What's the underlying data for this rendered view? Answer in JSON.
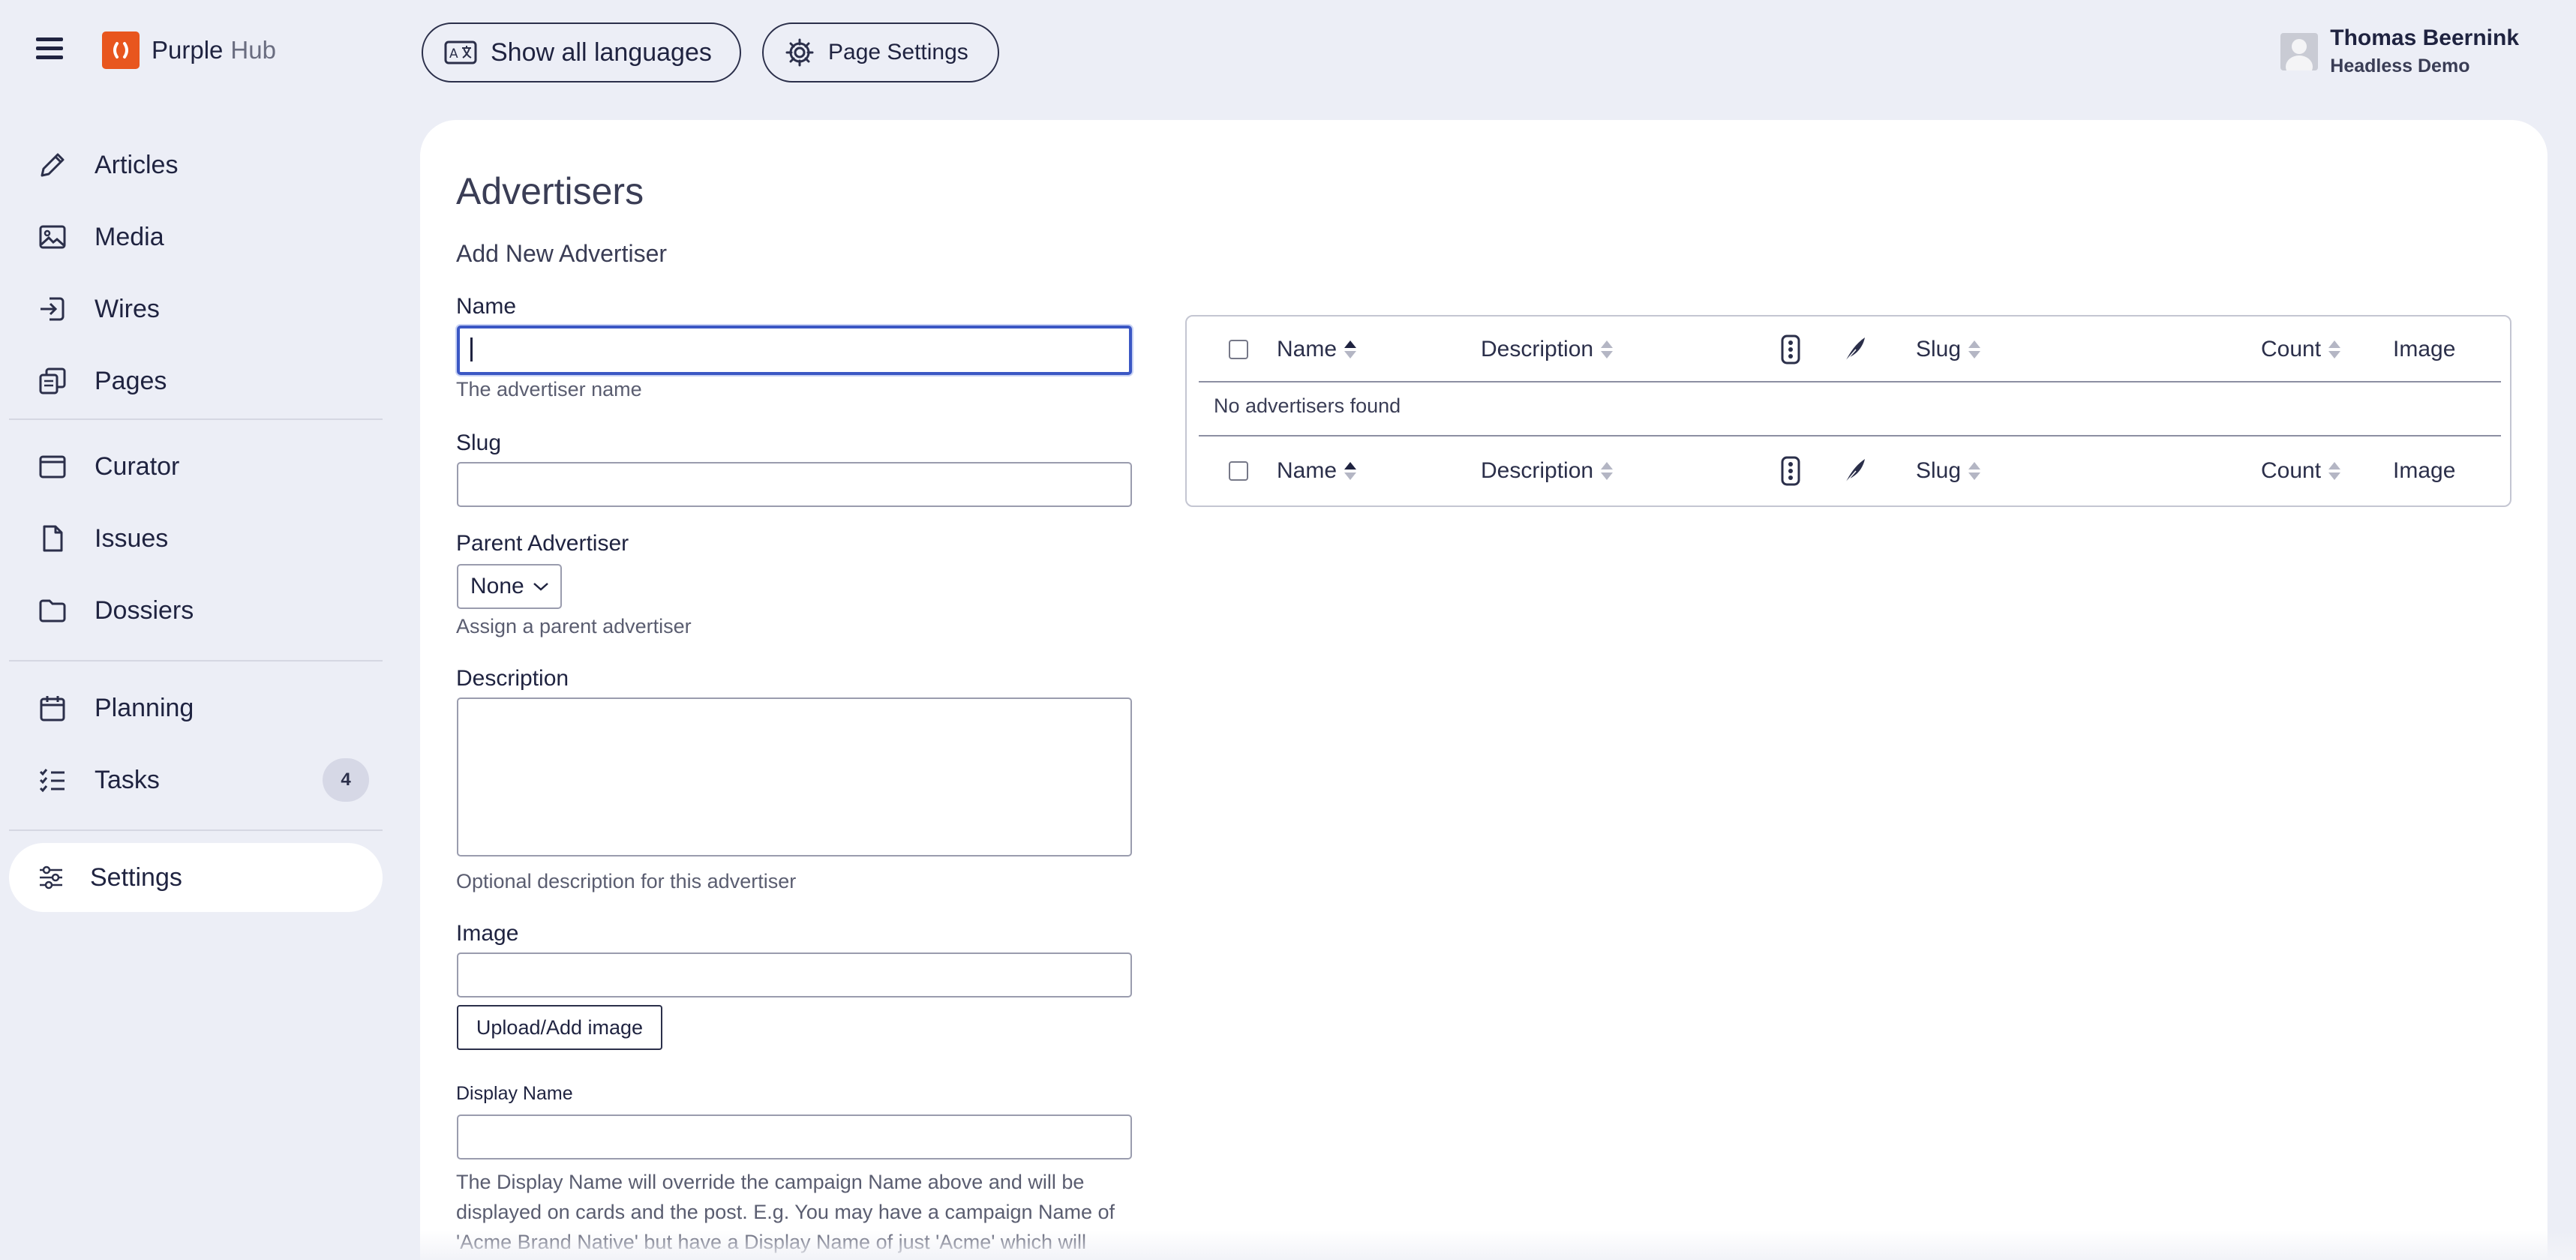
{
  "header": {
    "brand_name": "Purple",
    "brand_sub": "Hub",
    "show_languages_label": "Show all languages",
    "page_settings_label": "Page Settings",
    "user_name": "Thomas Beernink",
    "user_org": "Headless Demo"
  },
  "sidebar": {
    "items": [
      {
        "label": "Articles",
        "icon": "pencil-icon"
      },
      {
        "label": "Media",
        "icon": "image-icon"
      },
      {
        "label": "Wires",
        "icon": "import-icon"
      },
      {
        "label": "Pages",
        "icon": "pages-icon"
      },
      {
        "label": "Curator",
        "icon": "browser-window-icon"
      },
      {
        "label": "Issues",
        "icon": "document-icon"
      },
      {
        "label": "Dossiers",
        "icon": "folder-icon"
      },
      {
        "label": "Planning",
        "icon": "calendar-icon"
      },
      {
        "label": "Tasks",
        "icon": "checklist-icon",
        "badge": "4"
      },
      {
        "label": "Settings",
        "icon": "sliders-icon",
        "active": true
      }
    ]
  },
  "main": {
    "page_title": "Advertisers",
    "form_title": "Add New Advertiser",
    "form": {
      "name_label": "Name",
      "name_value": "",
      "name_hint": "The advertiser name",
      "slug_label": "Slug",
      "slug_value": "",
      "parent_label": "Parent Advertiser",
      "parent_value": "None",
      "parent_hint": "Assign a parent advertiser",
      "description_label": "Description",
      "description_value": "",
      "description_hint": "Optional description for this advertiser",
      "image_label": "Image",
      "image_value": "",
      "upload_button": "Upload/Add image",
      "display_name_label": "Display Name",
      "display_name_value": "",
      "display_name_help": "The Display Name will override the campaign Name above and will be displayed on cards and the post. E.g. You may have a campaign Name of 'Acme Brand Native' but have a Display Name of just 'Acme' which will"
    },
    "table": {
      "columns": [
        "Name",
        "Description",
        "Slug",
        "Count",
        "Image"
      ],
      "icon_columns": [
        "traffic-light-icon",
        "feather-icon"
      ],
      "sorted_column": "Name",
      "empty_message": "No advertisers found"
    }
  },
  "colors": {
    "background": "#eceef6",
    "card": "#ffffff",
    "brand_orange": "#e8561e",
    "focus_blue": "#3b57c4",
    "text": "#1f2340"
  }
}
